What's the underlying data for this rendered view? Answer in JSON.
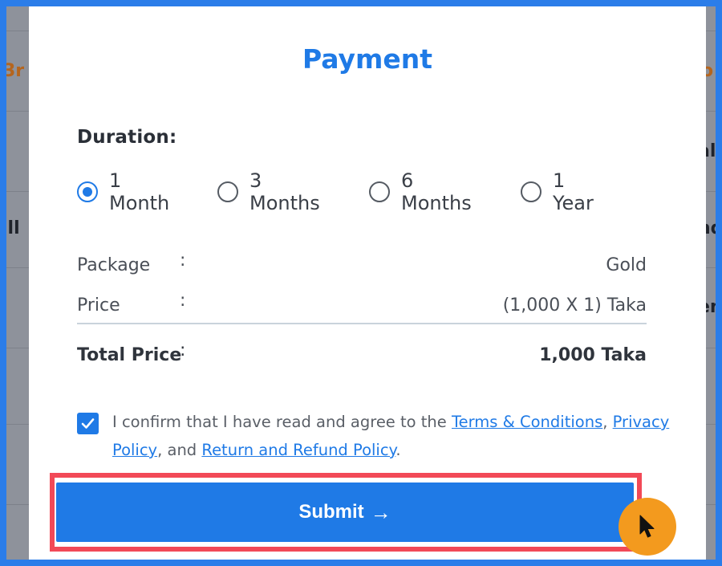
{
  "background": {
    "left_fragments": [
      "3r",
      "ill"
    ],
    "right_fragments": [
      "o",
      "al",
      "nd",
      "en"
    ]
  },
  "modal": {
    "title": "Payment",
    "duration_label": "Duration:",
    "durations": [
      {
        "label": "1 Month",
        "selected": true
      },
      {
        "label": "3 Months",
        "selected": false
      },
      {
        "label": "6 Months",
        "selected": false
      },
      {
        "label": "1 Year",
        "selected": false
      }
    ],
    "summary": {
      "separator": ":",
      "package_label": "Package",
      "package_value": "Gold",
      "price_label": "Price",
      "price_value": "(1,000 X 1) Taka",
      "total_label": "Total Price",
      "total_value": "1,000 Taka"
    },
    "consent": {
      "checked": true,
      "prefix": "I confirm that I have read and agree to the ",
      "terms_link": "Terms & Conditions",
      "comma": ", ",
      "privacy_link": "Privacy Policy",
      "middle": ", and ",
      "refund_link": "Return and Refund Policy",
      "suffix": "."
    },
    "submit_label": "Submit",
    "submit_arrow": "→"
  },
  "colors": {
    "accent": "#1f7ae6",
    "highlight": "#f24957",
    "cursor_badge": "#f39a1e",
    "frame": "#2b7de9"
  },
  "icons": {
    "submit_arrow": "arrow-right-icon",
    "checkbox": "checkmark-icon",
    "pointer": "mouse-pointer-icon"
  }
}
